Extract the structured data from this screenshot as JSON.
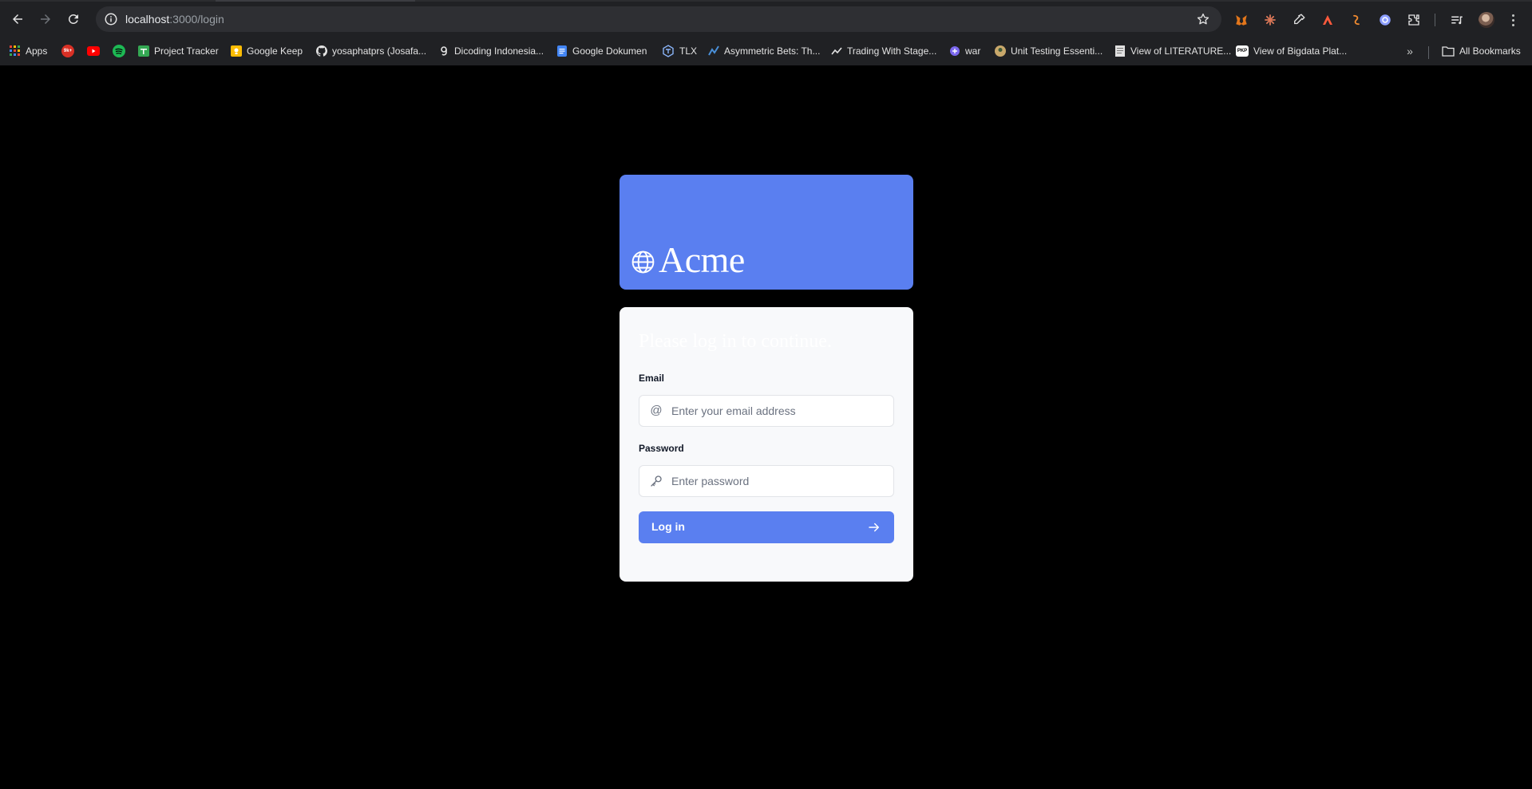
{
  "browser": {
    "url_host": "localhost",
    "url_path": ":3000/login",
    "bookmarks": [
      {
        "label": "Apps",
        "icon": "apps-grid-icon",
        "color": "#4285f4"
      },
      {
        "label": "",
        "icon": "9k-badge-icon",
        "badge": "9k+",
        "color": "#d93025"
      },
      {
        "label": "",
        "icon": "youtube-icon",
        "color": "#ff0000"
      },
      {
        "label": "",
        "icon": "spotify-icon",
        "color": "#1db954"
      },
      {
        "label": "Project Tracker",
        "icon": "sheets-icon",
        "color": "#34a853"
      },
      {
        "label": "Google Keep",
        "icon": "keep-icon",
        "color": "#fbbc04"
      },
      {
        "label": "yosaphatprs (Josafa...",
        "icon": "github-icon",
        "color": "#ffffff"
      },
      {
        "label": "Dicoding Indonesia...",
        "icon": "dicoding-icon",
        "color": "#ffffff"
      },
      {
        "label": "Google Dokumen",
        "icon": "docs-icon",
        "color": "#4285f4"
      },
      {
        "label": "TLX",
        "icon": "tlx-icon",
        "color": "#8ab4f8"
      },
      {
        "label": "Asymmetric Bets: Th...",
        "icon": "chart-icon",
        "color": "#4a90d9"
      },
      {
        "label": "Trading With Stage...",
        "icon": "trend-icon",
        "color": "#ffffff"
      },
      {
        "label": "war",
        "icon": "war-icon",
        "color": "#7b68ee"
      },
      {
        "label": "Unit Testing Essenti...",
        "icon": "testing-icon",
        "color": "#c9a86b"
      },
      {
        "label": "View of LITERATURE...",
        "icon": "document-icon",
        "color": "#e0e0e0"
      },
      {
        "label": "View of Bigdata Plat...",
        "icon": "pkp-icon",
        "badge": "PKP",
        "color": "#ffffff"
      }
    ],
    "all_bookmarks": "All Bookmarks"
  },
  "brand": {
    "name": "Acme",
    "color": "#5a7ff0"
  },
  "login": {
    "heading": "Please log in to continue.",
    "email_label": "Email",
    "email_placeholder": "Enter your email address",
    "password_label": "Password",
    "password_placeholder": "Enter password",
    "submit_label": "Log in"
  }
}
